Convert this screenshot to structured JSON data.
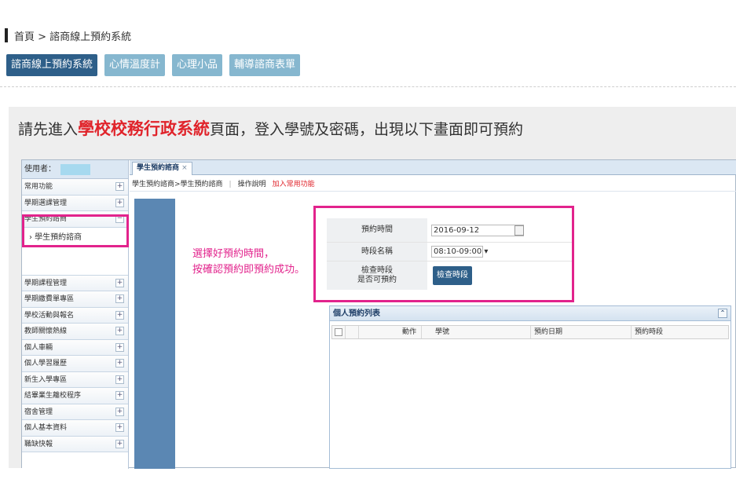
{
  "breadcrumb": {
    "text": "首頁 > 諮商線上預約系統"
  },
  "tabs": [
    {
      "label": "諮商線上預約系統",
      "active": true
    },
    {
      "label": "心情溫度計",
      "active": false
    },
    {
      "label": "心理小品",
      "active": false
    },
    {
      "label": "輔導諮商表單",
      "active": false
    }
  ],
  "instruction": {
    "before": "請先進入",
    "highlight": "學校校務行政系統",
    "after": "頁面，登入學號及密碼，出現以下畫面即可預約"
  },
  "screenshot": {
    "user_label": "使用者：",
    "menu_top": [
      "常用功能",
      "學期選課管理"
    ],
    "menu_expanded": {
      "label": "學生預約諮商",
      "sub_item": "› 學生預約諮商"
    },
    "menu_bottom": [
      "學期課程管理",
      "學期繳費單專區",
      "學校活動與報名",
      "教師關懷熱線",
      "個人車輛",
      "個人學習履歷",
      "新生入學專區",
      "結畢業生離校程序",
      "宿舍管理",
      "個人基本資料",
      "職缺快報"
    ],
    "tab_title": "學生預約諮商",
    "crumb": {
      "path": "學生預約諮商>學生預約諮商",
      "help": "操作說明",
      "add_fav": "加入常用功能"
    },
    "note": [
      "選擇好預約時間，",
      "按確認預約即預約成功。"
    ],
    "form": {
      "time_label": "預約時間",
      "date_value": "2016-09-12",
      "slot_label": "時段名稱",
      "slot_value": "08:10-09:00 ▾",
      "check_label_1": "檢查時段",
      "check_label_2": "是否可預約",
      "check_button": "檢查時段"
    },
    "list": {
      "title": "個人預約列表",
      "collapse_icon": "⌃",
      "columns": [
        "動作",
        "學號",
        "預約日期",
        "預約時段"
      ]
    }
  },
  "colors": {
    "accent": "#2e5f89",
    "tab_inactive": "#86b7cf",
    "highlight_red": "#e0242b",
    "annotation_pink": "#e2238c"
  }
}
